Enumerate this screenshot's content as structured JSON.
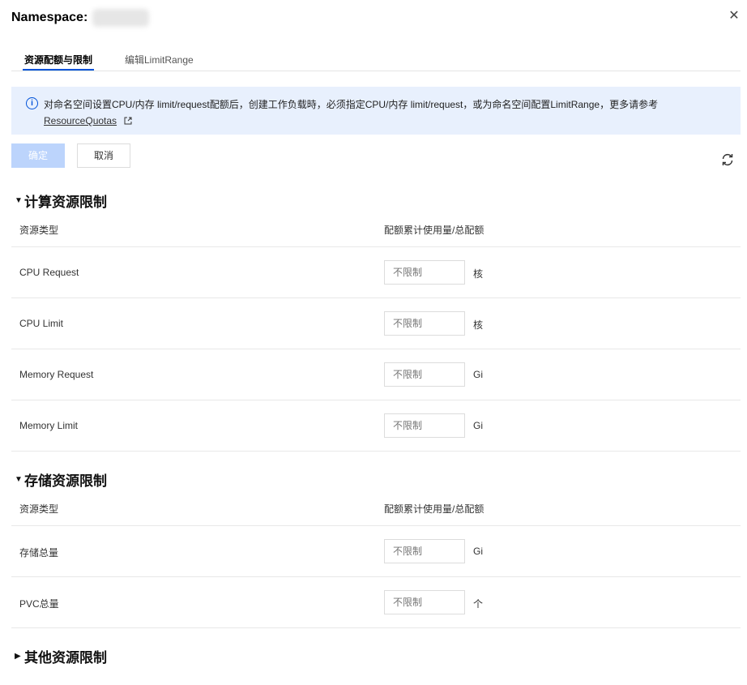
{
  "header": {
    "title": "Namespace:"
  },
  "tabs": [
    {
      "label": "资源配额与限制"
    },
    {
      "label": "编辑LimitRange"
    }
  ],
  "banner": {
    "text": "对命名空间设置CPU/内存 limit/request配额后，创建工作负载時，必须指定CPU/内存 limit/request，或为命名空间配置LimitRange，更多请参考",
    "link": "ResourceQuotas"
  },
  "buttons": {
    "ok": "确定",
    "cancel": "取消"
  },
  "compute": {
    "title": "计算资源限制",
    "col_type": "资源类型",
    "col_quota": "配额累计使用量/总配额",
    "rows": [
      {
        "label": "CPU Request",
        "placeholder": "不限制",
        "unit": "核"
      },
      {
        "label": "CPU Limit",
        "placeholder": "不限制",
        "unit": "核"
      },
      {
        "label": "Memory Request",
        "placeholder": "不限制",
        "unit": "Gi"
      },
      {
        "label": "Memory Limit",
        "placeholder": "不限制",
        "unit": "Gi"
      }
    ]
  },
  "storage": {
    "title": "存储资源限制",
    "col_type": "资源类型",
    "col_quota": "配额累计使用量/总配额",
    "rows": [
      {
        "label": "存储总量",
        "placeholder": "不限制",
        "unit": "Gi"
      },
      {
        "label": "PVC总量",
        "placeholder": "不限制",
        "unit": "个"
      }
    ]
  },
  "other": {
    "title": "其他资源限制"
  },
  "colors": {
    "accent": "#0052d9",
    "banner_bg": "#e8f0fd",
    "ok_disabled": "#bcd4fc"
  }
}
